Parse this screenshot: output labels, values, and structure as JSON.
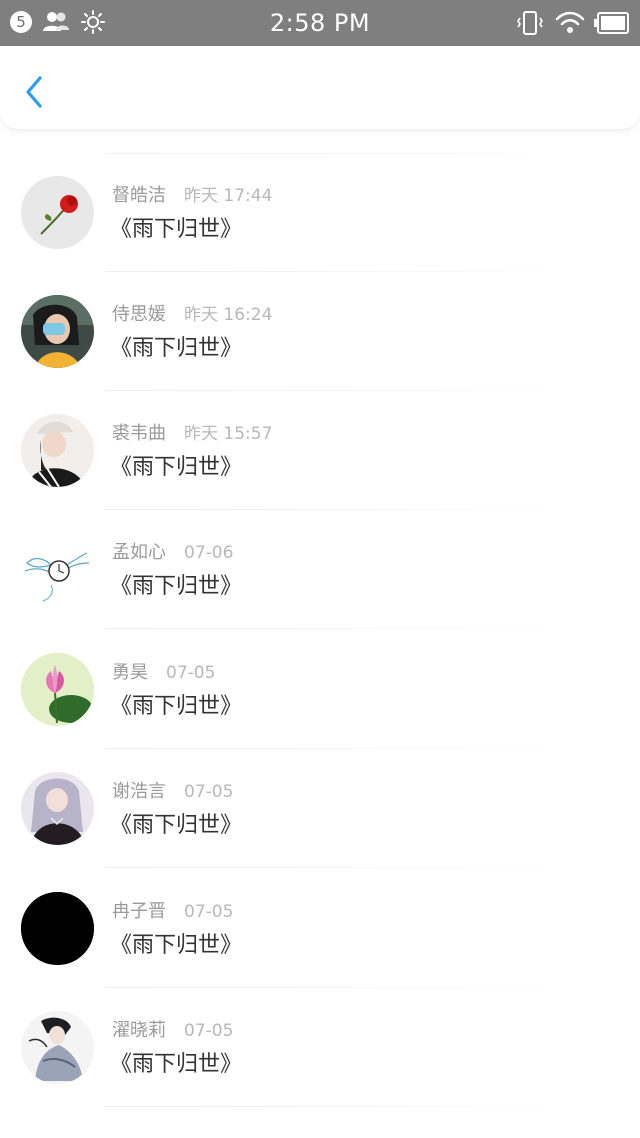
{
  "status_bar": {
    "notification_count": "5",
    "time": "2:58 PM"
  },
  "header": {
    "back_icon": "chevron-left-icon",
    "accent_color": "#2a9df4"
  },
  "items": [
    {
      "name": "督皓洁",
      "time": "昨天 17:44",
      "message": "《雨下归世》",
      "avatar": "red-rose"
    },
    {
      "name": "侍思媛",
      "time": "昨天 16:24",
      "message": "《雨下归世》",
      "avatar": "girl-yellow-shirt"
    },
    {
      "name": "裘韦曲",
      "time": "昨天 15:57",
      "message": "《雨下归世》",
      "avatar": "girl-cap"
    },
    {
      "name": "孟如心",
      "time": "07-06",
      "message": "《雨下归世》",
      "avatar": "winged-clock"
    },
    {
      "name": "勇昊",
      "time": "07-05",
      "message": "《雨下归世》",
      "avatar": "lotus"
    },
    {
      "name": "谢浩言",
      "time": "07-05",
      "message": "《雨下归世》",
      "avatar": "anime-girl"
    },
    {
      "name": "冉子晋",
      "time": "07-05",
      "message": "《雨下归世》",
      "avatar": "black"
    },
    {
      "name": "濯晓莉",
      "time": "07-05",
      "message": "《雨下归世》",
      "avatar": "ink-figure"
    }
  ]
}
